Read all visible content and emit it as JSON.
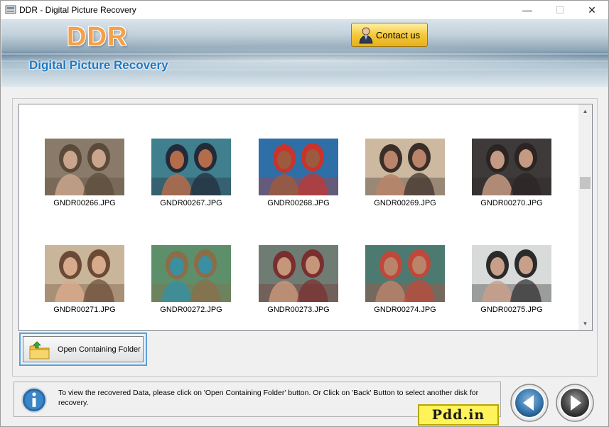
{
  "window": {
    "title": "DDR - Digital Picture Recovery",
    "controls": {
      "minimize": "—",
      "maximize": "☐",
      "close": "✕"
    }
  },
  "header": {
    "logo": "DDR",
    "subtitle": "Digital Picture Recovery",
    "contact_label": "Contact us",
    "contact_icon": "person-icon"
  },
  "gallery": {
    "items": [
      {
        "filename": "GNDR00266.JPG",
        "palette": [
          "#8a7a6a",
          "#c9a58d",
          "#5a4a3a"
        ]
      },
      {
        "filename": "GNDR00267.JPG",
        "palette": [
          "#3f7f8e",
          "#b56c4a",
          "#222b3a"
        ]
      },
      {
        "filename": "GNDR00268.JPG",
        "palette": [
          "#2f6fa8",
          "#9c5a3f",
          "#c8342c"
        ]
      },
      {
        "filename": "GNDR00269.JPG",
        "palette": [
          "#cdb9a0",
          "#b9846a",
          "#3a2e28"
        ]
      },
      {
        "filename": "GNDR00270.JPG",
        "palette": [
          "#3e3a3a",
          "#c49a82",
          "#2b2424"
        ]
      },
      {
        "filename": "GNDR00271.JPG",
        "palette": [
          "#c9b59a",
          "#d8aa8c",
          "#6a4a36"
        ]
      },
      {
        "filename": "GNDR00272.JPG",
        "palette": [
          "#5d8f6a",
          "#3a8fa0",
          "#8d6c48"
        ]
      },
      {
        "filename": "GNDR00273.JPG",
        "palette": [
          "#6e7c74",
          "#c6967a",
          "#7a2e2e"
        ]
      },
      {
        "filename": "GNDR00274.JPG",
        "palette": [
          "#4d7a70",
          "#b9846a",
          "#c0483a"
        ]
      },
      {
        "filename": "GNDR00275.JPG",
        "palette": [
          "#d8dbd9",
          "#c8a08a",
          "#2a2a2a"
        ]
      }
    ]
  },
  "actions": {
    "open_folder_label": "Open Containing Folder",
    "open_folder_icon": "folder-icon"
  },
  "info": {
    "icon": "info-icon",
    "text": "To view the recovered Data, please click on 'Open Containing Folder' button. Or Click on 'Back' Button to select another disk for recovery."
  },
  "navigation": {
    "back_icon": "back-arrow-icon",
    "next_icon": "next-arrow-icon"
  },
  "watermark": "Pdd.in"
}
